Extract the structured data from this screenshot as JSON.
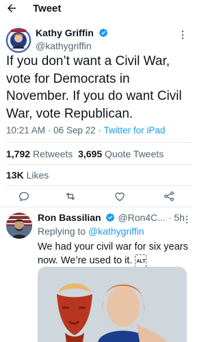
{
  "header": {
    "title": "Tweet"
  },
  "tweet": {
    "author_name": "Kathy Griffin",
    "author_handle": "@kathygriffin",
    "text": "If you don’t want a Civil War, vote for Democrats in November. If you do want Civil War, vote Republican.",
    "time": "10:21 AM",
    "date": "06 Sep 22",
    "source": "Twitter for iPad",
    "retweets_count": "1,792",
    "retweets_label": "Retweets",
    "quotes_count": "3,695",
    "quotes_label": "Quote Tweets",
    "likes_count": "13K",
    "likes_label": "Likes"
  },
  "reply": {
    "author_name": "Ron Bassilian",
    "author_handle": "@Ron4C...",
    "age": "5h",
    "replying_prefix": "Replying to",
    "replying_handle": "@kathygriffin",
    "text": "We had your civil war for six years now. We’re used to it.",
    "alt_badge": "ALT"
  },
  "colors": {
    "accent": "#1d9bf0",
    "secondary_text": "#536471",
    "divider": "#e6ecf0"
  },
  "icons": [
    "back-arrow-icon",
    "verified-badge-icon",
    "more-icon",
    "reply-icon",
    "retweet-icon",
    "like-icon",
    "share-icon"
  ]
}
